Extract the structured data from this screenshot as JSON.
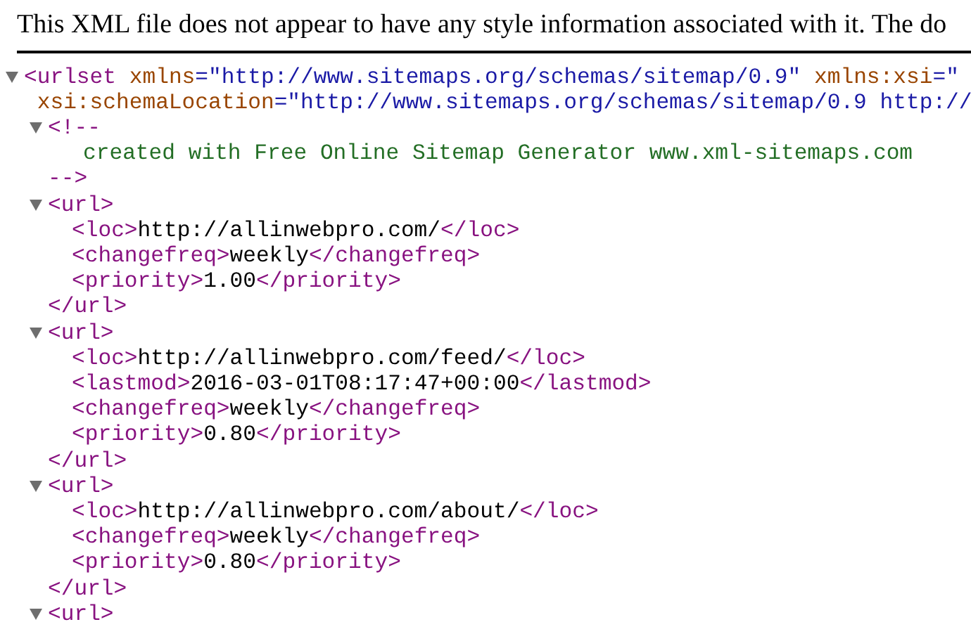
{
  "notice": "This XML file does not appear to have any style information associated with it. The do",
  "tree": [
    {
      "kind": "element",
      "open": "<urlset",
      "expanded": true,
      "open_tag_lines": [
        [
          {
            "name": "xmlns",
            "value": "=\"http://www.sitemaps.org/schemas/sitemap/0.9\""
          },
          {
            "name": "xmlns:xsi",
            "value": "=\""
          }
        ],
        [
          {
            "name": "xsi:schemaLocation",
            "value": "=\"http://www.sitemaps.org/schemas/sitemap/0.9 http://"
          }
        ]
      ],
      "children": [
        {
          "kind": "comment",
          "open": "<!--",
          "text": "created with Free Online Sitemap Generator www.xml-sitemaps.com",
          "close": "-->",
          "expanded": true
        },
        {
          "kind": "element",
          "open": "<url>",
          "expanded": true,
          "close": "</url>",
          "children": [
            {
              "kind": "leaf",
              "open": "<loc>",
              "text": "http://allinwebpro.com/",
              "close": "</loc>"
            },
            {
              "kind": "leaf",
              "open": "<changefreq>",
              "text": "weekly",
              "close": "</changefreq>"
            },
            {
              "kind": "leaf",
              "open": "<priority>",
              "text": "1.00",
              "close": "</priority>"
            }
          ]
        },
        {
          "kind": "element",
          "open": "<url>",
          "expanded": true,
          "close": "</url>",
          "children": [
            {
              "kind": "leaf",
              "open": "<loc>",
              "text": "http://allinwebpro.com/feed/",
              "close": "</loc>"
            },
            {
              "kind": "leaf",
              "open": "<lastmod>",
              "text": "2016-03-01T08:17:47+00:00",
              "close": "</lastmod>"
            },
            {
              "kind": "leaf",
              "open": "<changefreq>",
              "text": "weekly",
              "close": "</changefreq>"
            },
            {
              "kind": "leaf",
              "open": "<priority>",
              "text": "0.80",
              "close": "</priority>"
            }
          ]
        },
        {
          "kind": "element",
          "open": "<url>",
          "expanded": true,
          "close": "</url>",
          "children": [
            {
              "kind": "leaf",
              "open": "<loc>",
              "text": "http://allinwebpro.com/about/",
              "close": "</loc>"
            },
            {
              "kind": "leaf",
              "open": "<changefreq>",
              "text": "weekly",
              "close": "</changefreq>"
            },
            {
              "kind": "leaf",
              "open": "<priority>",
              "text": "0.80",
              "close": "</priority>"
            }
          ]
        },
        {
          "kind": "element",
          "open": "<url>",
          "expanded": true
        }
      ]
    }
  ]
}
